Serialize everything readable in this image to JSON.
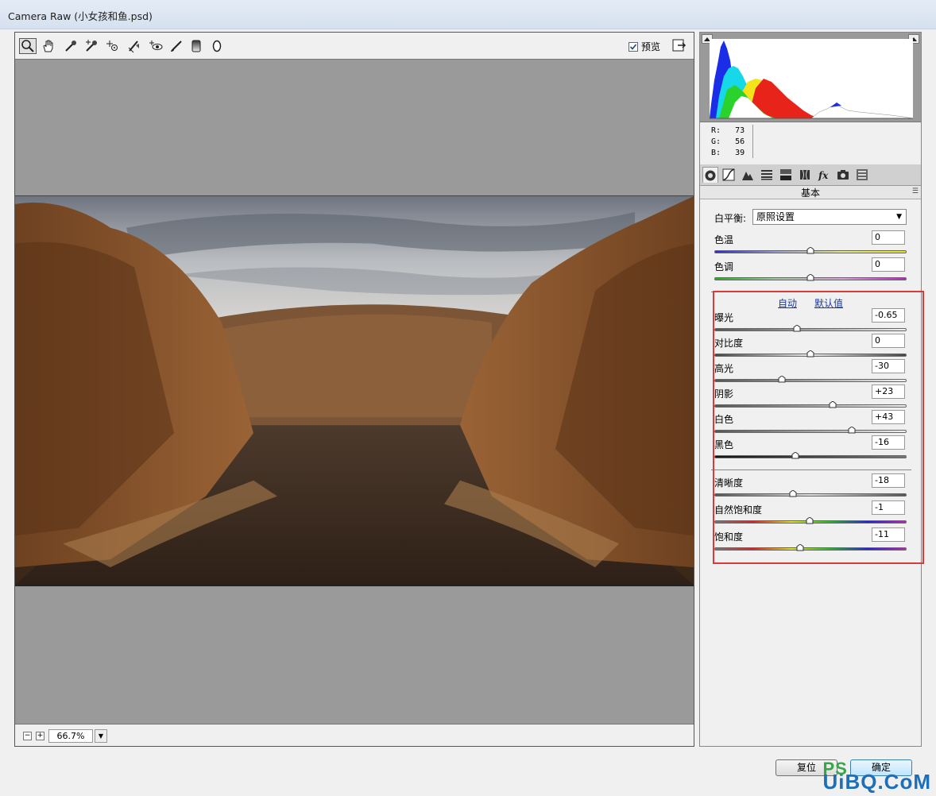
{
  "window": {
    "title": "Camera Raw (小女孩和鱼.psd)"
  },
  "toolbar": {
    "tools": [
      {
        "icon": "zoom-icon"
      },
      {
        "icon": "hand-icon"
      },
      {
        "icon": "white-balance-icon"
      },
      {
        "icon": "color-sampler-icon"
      },
      {
        "icon": "target-adjust-icon"
      },
      {
        "icon": "crop-straighten-icon"
      },
      {
        "icon": "red-eye-icon"
      },
      {
        "icon": "brush-icon"
      },
      {
        "icon": "graduated-filter-icon"
      },
      {
        "icon": "radial-filter-icon"
      }
    ],
    "preview_label": "预览",
    "preview_checked": true
  },
  "status": {
    "zoom": "66.7%",
    "zoom_out": "−",
    "zoom_in": "+"
  },
  "rgb": {
    "r_label": "R:",
    "r": "73",
    "g_label": "G:",
    "g": "56",
    "b_label": "B:",
    "b": "39"
  },
  "panel": {
    "section_title": "基本",
    "white_balance_label": "白平衡:",
    "white_balance_value": "原照设置",
    "auto_link": "自动",
    "default_link": "默认值",
    "sliders": [
      {
        "key": "temp",
        "label": "色温",
        "value": "0",
        "level": 0.5
      },
      {
        "key": "tint",
        "label": "色调",
        "value": "0",
        "level": 0.5
      },
      {
        "key": "exposure",
        "label": "曝光",
        "value": "-0.65",
        "level": 0.43
      },
      {
        "key": "contrast",
        "label": "对比度",
        "value": "0",
        "level": 0.5
      },
      {
        "key": "highlights",
        "label": "高光",
        "value": "-30",
        "level": 0.35
      },
      {
        "key": "shadows",
        "label": "阴影",
        "value": "+23",
        "level": 0.615
      },
      {
        "key": "whites",
        "label": "白色",
        "value": "+43",
        "level": 0.715
      },
      {
        "key": "blacks",
        "label": "黑色",
        "value": "-16",
        "level": 0.42
      },
      {
        "key": "clarity",
        "label": "清晰度",
        "value": "-18",
        "level": 0.41
      },
      {
        "key": "vibrance",
        "label": "自然饱和度",
        "value": "-1",
        "level": 0.495
      },
      {
        "key": "saturation",
        "label": "饱和度",
        "value": "-11",
        "level": 0.445
      }
    ]
  },
  "buttons": {
    "reset": "复位",
    "ok": "确定"
  },
  "watermark": {
    "ps": "PS",
    "site": "UiBQ.CoM"
  },
  "colors": {
    "highlight_box": "#d93a3a",
    "link": "#1a3c9c"
  }
}
